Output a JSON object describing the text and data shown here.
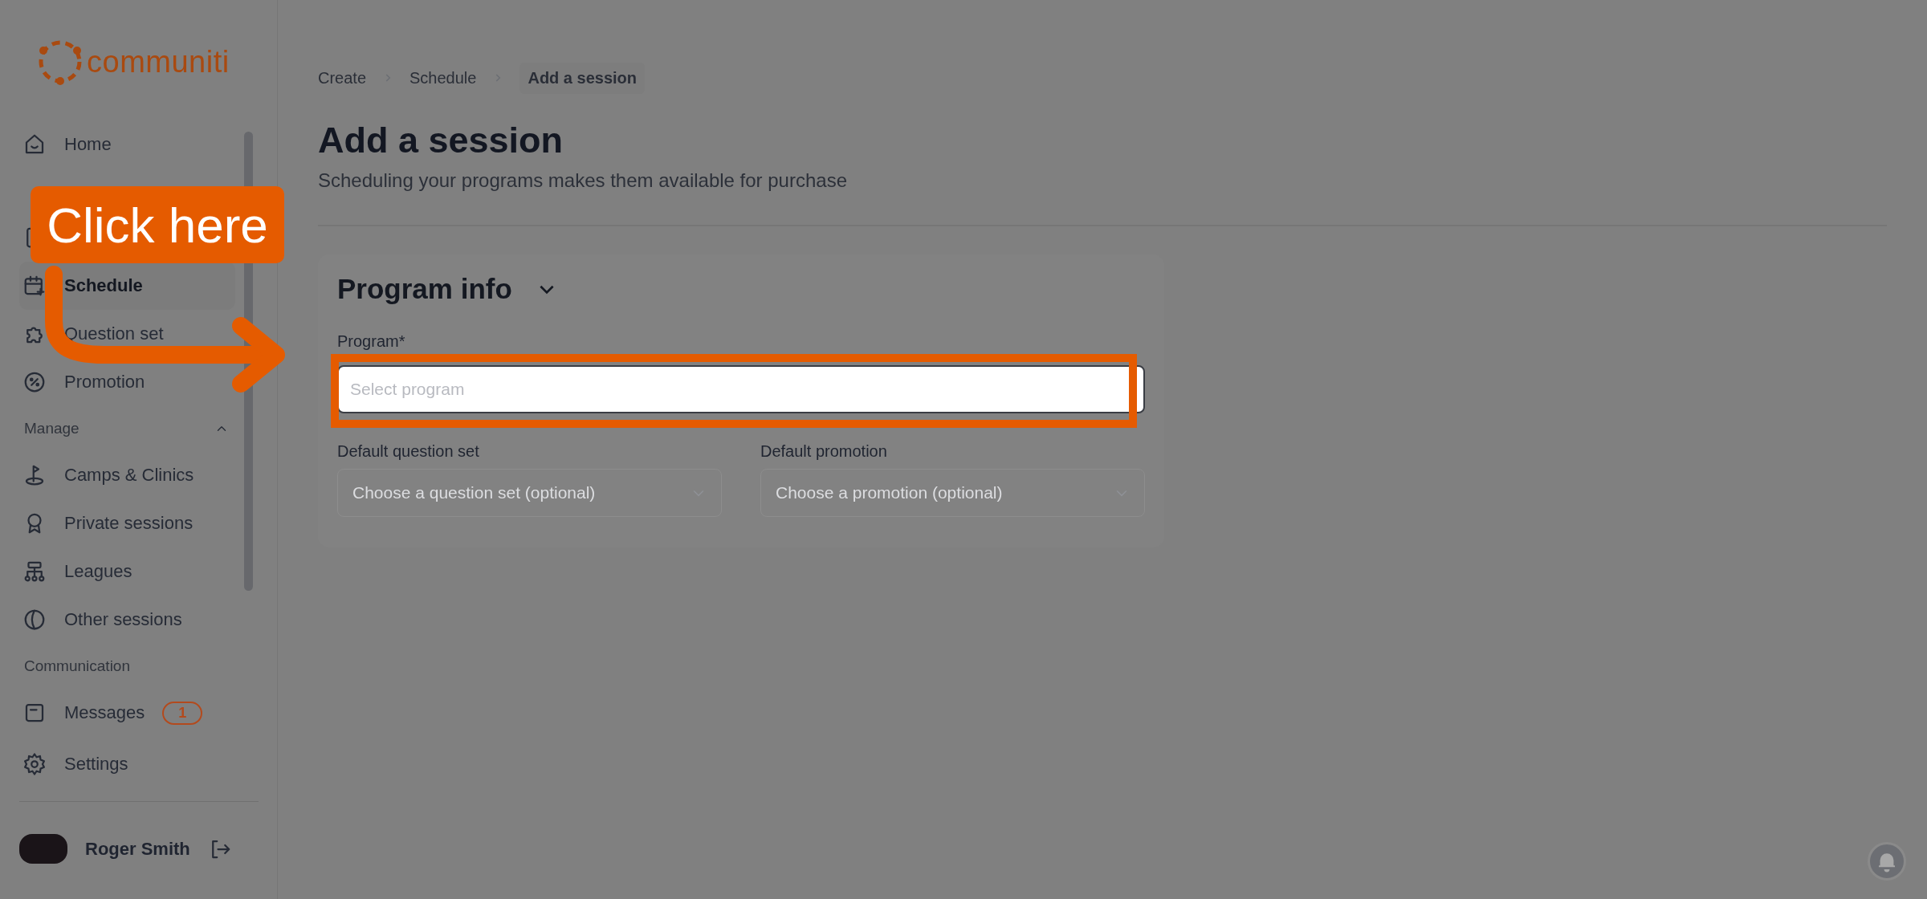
{
  "sidebar": {
    "logo": "communiti",
    "items": [
      {
        "kind": "item",
        "label": "Home",
        "selected": false
      },
      {
        "kind": "section"
      },
      {
        "kind": "item"
      },
      {
        "kind": "item",
        "label": "Schedule",
        "selected": true
      },
      {
        "kind": "item",
        "label": "Question set",
        "selected": false
      },
      {
        "kind": "item",
        "label": "Promotion",
        "selected": false
      },
      {
        "kind": "section",
        "label": "Manage",
        "expanded": true
      },
      {
        "kind": "item",
        "label": "Camps & Clinics",
        "selected": false
      },
      {
        "kind": "item",
        "label": "Private sessions",
        "selected": false
      },
      {
        "kind": "item",
        "label": "Leagues",
        "selected": false
      },
      {
        "kind": "item",
        "label": "Other sessions",
        "selected": false
      },
      {
        "kind": "section",
        "label": "Communication"
      },
      {
        "kind": "item",
        "label": "Messages",
        "badge": "1",
        "selected": false
      }
    ],
    "settings": "Settings",
    "user": "Roger Smith"
  },
  "breadcrumb": [
    {
      "label": "Create",
      "selected": false
    },
    {
      "label": "Schedule",
      "selected": false
    },
    {
      "label": "Add a session",
      "selected": true
    }
  ],
  "title": "Add a session",
  "subtitle": "Scheduling your programs makes them available for purchase",
  "card": {
    "title": "Program info",
    "expanded": true,
    "program": {
      "label": "Program*",
      "placeholder": "Select program"
    },
    "fields": [
      {
        "label": "Default question set",
        "placeholder": "Choose a question set (optional)"
      },
      {
        "label": "Default promotion",
        "placeholder": "Choose a promotion (optional)"
      }
    ]
  },
  "callout": "Click here"
}
